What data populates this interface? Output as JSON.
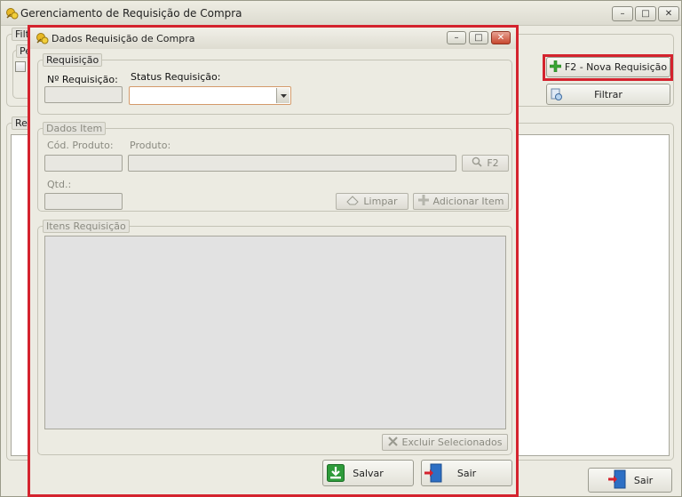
{
  "main_window": {
    "title": "Gerenciamento de Requisição de Compra",
    "filter_group_title": "Filt",
    "period_group_title": "Pe",
    "requisitions_group_title": "Req",
    "nova_requisicao_label": "F2 - Nova Requisição",
    "filtrar_label": "Filtrar",
    "sair_label": "Sair"
  },
  "dialog": {
    "title": "Dados Requisição de Compra",
    "requisicao": {
      "group_title": "Requisição",
      "numero_label": "Nº Requisição:",
      "numero_value": "",
      "status_label": "Status Requisição:",
      "status_value": ""
    },
    "dados_item": {
      "group_title": "Dados Item",
      "cod_produto_label": "Cód. Produto:",
      "cod_produto_value": "",
      "produto_label": "Produto:",
      "produto_value": "",
      "f2_label": "F2",
      "qtd_label": "Qtd.:",
      "qtd_value": "",
      "limpar_label": "Limpar",
      "adicionar_label": "Adicionar Item"
    },
    "itens_requisicao": {
      "group_title": "Itens Requisição",
      "excluir_label": "Excluir Selecionados"
    },
    "salvar_label": "Salvar",
    "sair_label": "Sair"
  },
  "colors": {
    "highlight": "#d4232e",
    "add_green": "#3aa534",
    "save_green": "#2e9b3a",
    "exit_blue": "#2d6fc4"
  },
  "icons": {
    "app": "app-icon",
    "nova_requisicao": "plus-icon",
    "filtrar": "filter-icon",
    "sair": "exit-door-icon",
    "salvar": "save-icon",
    "search": "search-icon",
    "limpar": "eraser-icon",
    "adicionar": "plus-icon",
    "excluir": "delete-x-icon"
  }
}
